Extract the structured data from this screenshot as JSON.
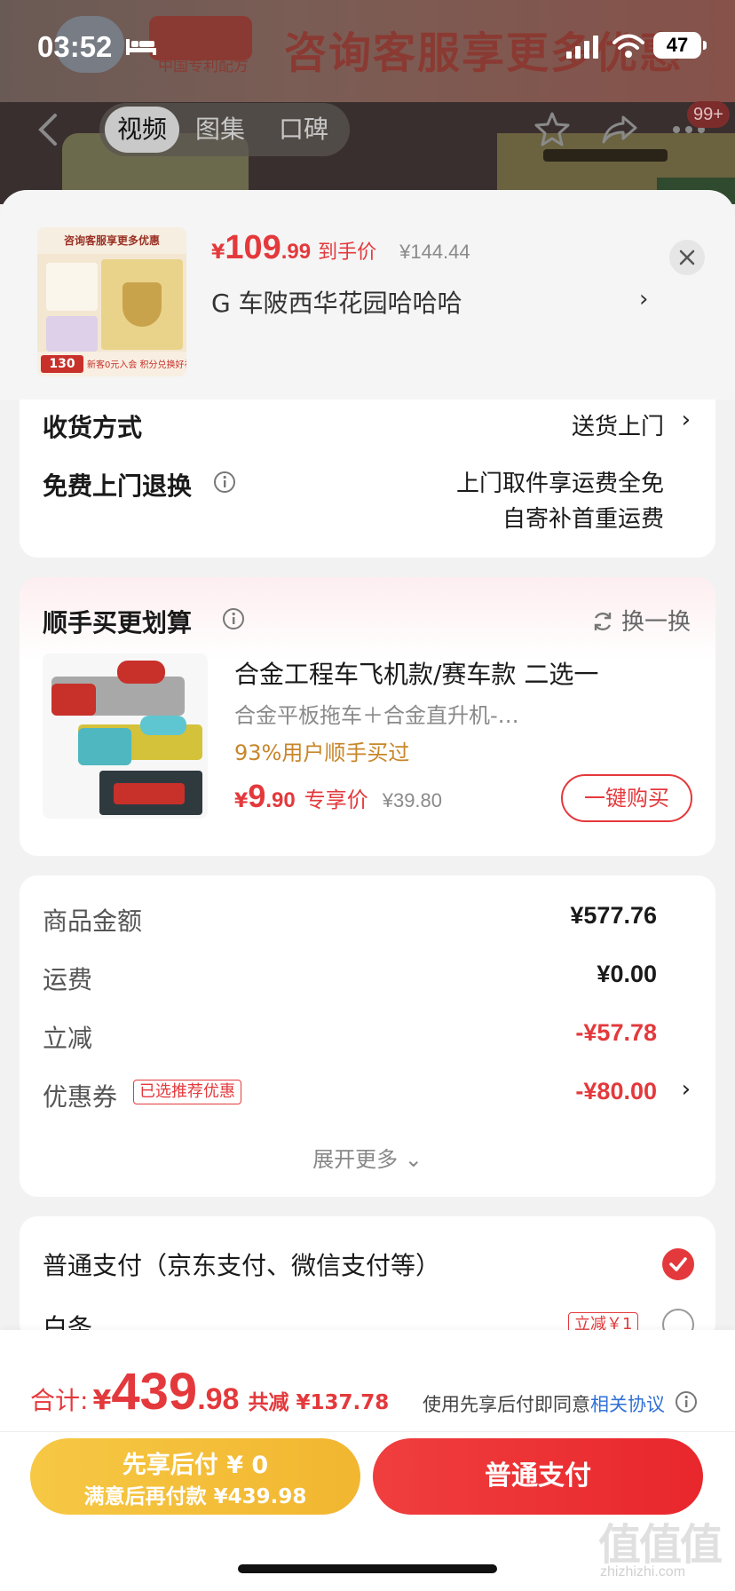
{
  "status_bar": {
    "time": "03:52",
    "battery": "47"
  },
  "background_page": {
    "banner_text": "咨询客服享更多优惠",
    "brand_sub": "中国专利配方",
    "media_tabs": [
      "视频",
      "图集",
      "口碑"
    ],
    "notification_badge": "99+"
  },
  "sheet": {
    "thumb": {
      "top_text": "咨询客服享更多优惠",
      "badge_value": "130",
      "bottom_text": "新客0元入会 积分兑换好礼"
    },
    "price": {
      "currency": "¥",
      "integer": "109",
      "decimal": ".99",
      "label": "到手价",
      "original": "¥144.44"
    },
    "address": "G  车陂西华花园哈哈哈",
    "address_arrow": "›",
    "close_icon": "close-icon"
  },
  "delivery": {
    "method_label": "收货方式",
    "method_value": "送货上门",
    "return_label": "免费上门退换",
    "return_value_line1": "上门取件享运费全免",
    "return_value_line2": "自寄补首重运费",
    "arrow": "›"
  },
  "addon": {
    "title": "顺手买更划算",
    "refresh_label": "换一换",
    "item": {
      "name": "合金工程车飞机款/赛车款 二选一",
      "desc": "合金平板拖车＋合金直升机-…",
      "bought": "93%用户顺手买过",
      "price_currency": "¥",
      "price_integer": "9",
      "price_decimal": ".90",
      "price_label": "专享价",
      "original_price": "¥39.80",
      "buy_button": "一键购买"
    }
  },
  "summary": {
    "rows": [
      {
        "label": "商品金额",
        "value": "¥577.76"
      },
      {
        "label": "运费",
        "value": "¥0.00"
      },
      {
        "label": "立减",
        "value": "-¥57.78"
      },
      {
        "label": "优惠券",
        "value": "-¥80.00"
      }
    ],
    "coupon_tag": "已选推荐优惠",
    "expand_more": "展开更多 ⌄"
  },
  "payment": {
    "normal_label": "普通支付（京东支付、微信支付等）",
    "baitiao_label": "白条",
    "baitiao_tag": "立减￥1"
  },
  "bottom_bar": {
    "total_label": "合计:",
    "total_currency": "¥",
    "total_integer": "439",
    "total_decimal": ".98",
    "total_saved": "共减 ¥137.78",
    "agree_text": "使用先享后付即同意",
    "agree_link": "相关协议",
    "later_line1": "先享后付 ¥ 0",
    "later_line2": "满意后再付款 ¥439.98",
    "pay_button": "普通支付"
  },
  "colors": {
    "accent_red": "#e4393c",
    "later_yellow": "#f2b630",
    "link_blue": "#2f6fd6",
    "bought_orange": "#c8862a"
  },
  "watermark": {
    "glyphs": "值值值",
    "url": "zhizhizhi.com"
  }
}
